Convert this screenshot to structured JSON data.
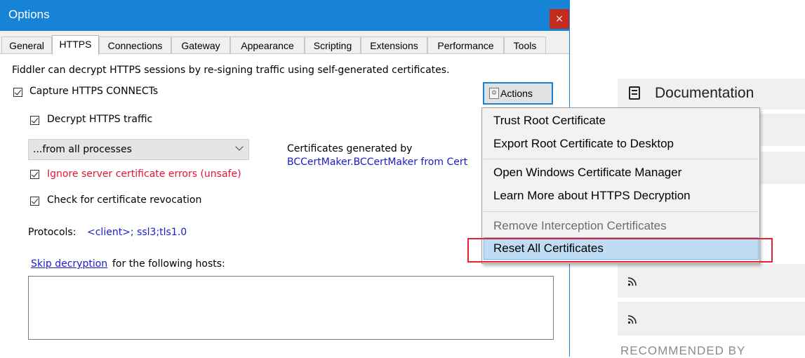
{
  "window": {
    "title": "Options",
    "close_glyph": "×"
  },
  "tabs": [
    {
      "label": "General"
    },
    {
      "label": "HTTPS",
      "active": true
    },
    {
      "label": "Connections"
    },
    {
      "label": "Gateway"
    },
    {
      "label": "Appearance"
    },
    {
      "label": "Scripting"
    },
    {
      "label": "Extensions"
    },
    {
      "label": "Performance"
    },
    {
      "label": "Tools"
    }
  ],
  "https": {
    "description": "Fiddler can decrypt HTTPS sessions by re-signing traffic using self-generated certificates.",
    "capture_connects": {
      "label": "Capture HTTPS CONNECTs",
      "checked": true
    },
    "decrypt_traffic": {
      "label": "Decrypt HTTPS traffic",
      "checked": true
    },
    "process_filter": {
      "selected": "...from all processes"
    },
    "ignore_errors": {
      "label": "Ignore server certificate errors (unsafe)",
      "checked": true
    },
    "check_revocation": {
      "label": "Check for certificate revocation",
      "checked": true
    },
    "certs_generated_label": "Certificates generated by",
    "certs_generated_value": "BCCertMaker.BCCertMaker from Cert",
    "protocols_label": "Protocols:",
    "protocols_value": "<client>; ssl3;tls1.0",
    "skip_link": "Skip decryption",
    "skip_suffix": " for the following hosts:",
    "hosts_value": ""
  },
  "actions_button": {
    "label": "Actions",
    "icon": "gear-icon"
  },
  "actions_menu": {
    "items": [
      {
        "label": "Trust Root Certificate",
        "enabled": true
      },
      {
        "label": "Export Root Certificate to Desktop",
        "enabled": true
      },
      {
        "label": "Open Windows Certificate Manager",
        "enabled": true
      },
      {
        "label": "Learn More about HTTPS Decryption",
        "enabled": true
      },
      {
        "label": "Remove Interception Certificates",
        "enabled": false
      },
      {
        "label": "Reset All Certificates",
        "enabled": true,
        "highlighted": true
      }
    ]
  },
  "background": {
    "documentation_label": "Documentation",
    "recommended_label": "RECOMMENDED BY"
  },
  "colors": {
    "title_bar": "#1783d7",
    "close_button": "#c42b1c",
    "link": "#1a1acc",
    "warning_text": "#e0153a",
    "menu_highlight": "#bedcf3",
    "callout": "#e3242b"
  }
}
